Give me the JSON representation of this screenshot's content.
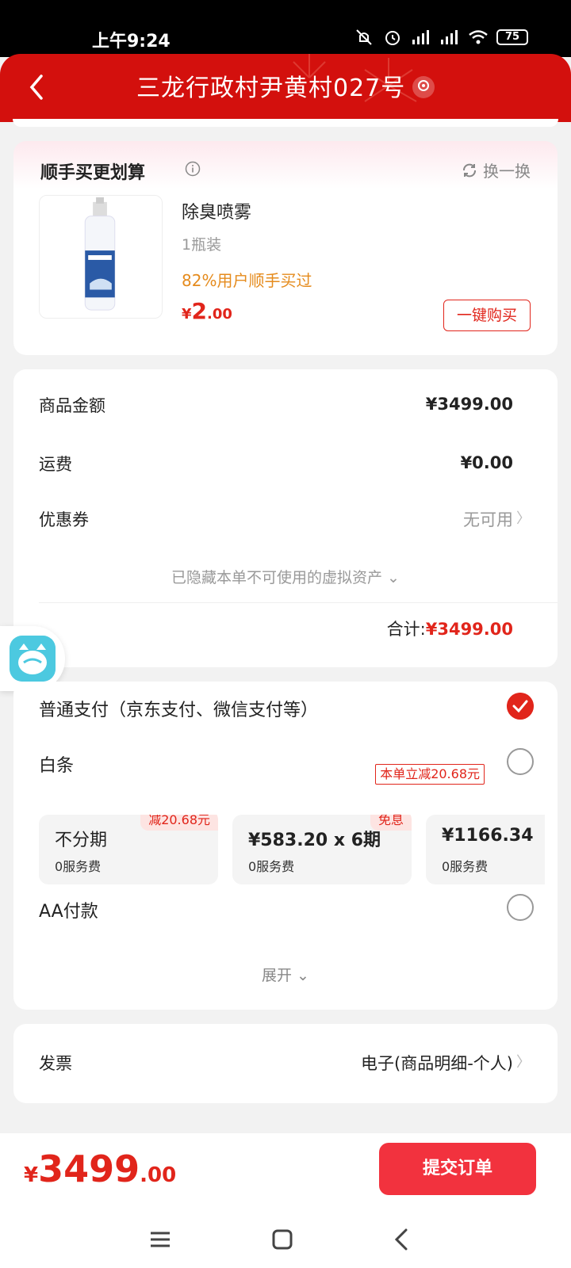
{
  "status_bar": {
    "time": "上午9:24",
    "battery": "75"
  },
  "header": {
    "title": "三龙行政村尹黄村027号"
  },
  "upsell": {
    "title": "顺手买更划算",
    "swap_label": "换一换",
    "product": {
      "name": "除臭喷雾",
      "spec": "1瓶装",
      "rate": "82%用户顺手买过",
      "currency": "¥",
      "price_int": "2",
      "price_dec": ".00",
      "buy_label": "一键购买"
    }
  },
  "summary": {
    "goods_label": "商品金额",
    "goods_value": "¥3499.00",
    "shipping_label": "运费",
    "shipping_value": "¥0.00",
    "coupon_label": "优惠券",
    "coupon_value": "无可用",
    "hidden_note": "已隐藏本单不可使用的虚拟资产 ⌄",
    "total_label": "合计:",
    "total_value": "¥3499.00"
  },
  "payment": {
    "normal_label": "普通支付（京东支付、微信支付等）",
    "baitiao_label": "白条",
    "baitiao_promo": "本单立减20.68元",
    "installments": [
      {
        "main": "不分期",
        "sub": "0服务费",
        "tag": "减20.68元"
      },
      {
        "main": "¥583.20 x 6期",
        "sub": "0服务费",
        "tag": "免息"
      },
      {
        "main": "¥1166.34",
        "sub": "0服务费",
        "tag": ""
      }
    ],
    "aa_label": "AA付款",
    "expand_label": "展开 ⌄"
  },
  "invoice": {
    "label": "发票",
    "value": "电子(商品明细-个人)"
  },
  "bottom": {
    "currency": "¥",
    "total_int": "3499",
    "total_dec": ".00",
    "submit_label": "提交订单"
  },
  "colors": {
    "brand_red": "#d3100d",
    "price_red": "#e1251b",
    "submit_red": "#f2323e",
    "rate_orange": "#e58b1d"
  }
}
